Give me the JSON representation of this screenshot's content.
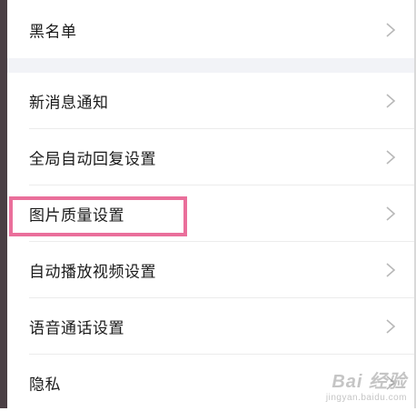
{
  "settings": {
    "items": [
      {
        "label": "黑名单"
      },
      {
        "label": "新消息通知"
      },
      {
        "label": "全局自动回复设置"
      },
      {
        "label": "图片质量设置"
      },
      {
        "label": "自动播放视频设置"
      },
      {
        "label": "语音通话设置"
      },
      {
        "label": "隐私"
      }
    ]
  },
  "highlight": {
    "color": "#ea6f9b",
    "target": "图片质量设置"
  },
  "watermark": {
    "main": "Bai 经验",
    "sub": "jingyan.baidu.com"
  },
  "icons": {
    "row_arrow": "chevron-right-icon"
  }
}
